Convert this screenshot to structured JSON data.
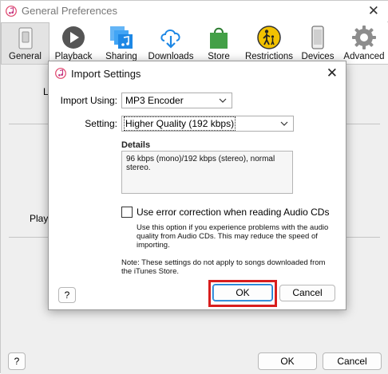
{
  "window": {
    "title": "General Preferences",
    "close_glyph": "✕"
  },
  "toolbar": {
    "items": [
      {
        "label": "General",
        "icon": "general-switch-icon",
        "active": true
      },
      {
        "label": "Playback",
        "icon": "play-icon"
      },
      {
        "label": "Sharing",
        "icon": "sharing-icon"
      },
      {
        "label": "Downloads",
        "icon": "cloud-download-icon"
      },
      {
        "label": "Store",
        "icon": "shopping-bag-icon"
      },
      {
        "label": "Restrictions",
        "icon": "restrictions-icon"
      },
      {
        "label": "Devices",
        "icon": "phone-icon"
      },
      {
        "label": "Advanced",
        "icon": "gear-icon"
      }
    ]
  },
  "background": {
    "frag_l": "L",
    "frag_playb": "Playb",
    "help_label": "?",
    "ok_label": "OK",
    "cancel_label": "Cancel"
  },
  "dialog": {
    "title": "Import Settings",
    "close_glyph": "✕",
    "import_using_label": "Import Using:",
    "import_using_value": "MP3 Encoder",
    "setting_label": "Setting:",
    "setting_value": "Higher Quality (192 kbps)",
    "details_heading": "Details",
    "details_text": "96 kbps (mono)/192 kbps (stereo), normal stereo.",
    "error_correction_label": "Use error correction when reading Audio CDs",
    "error_correction_checked": false,
    "hint_text": "Use this option if you experience problems with the audio quality from Audio CDs.  This may reduce the speed of importing.",
    "note_text": "Note: These settings do not apply to songs downloaded from the iTunes Store.",
    "help_label": "?",
    "ok_label": "OK",
    "cancel_label": "Cancel"
  },
  "colors": {
    "highlight_border": "#d81e1e",
    "focus_blue": "#1a7bd1",
    "play_icon": "#555555",
    "sharing_icon": "#1e88e5",
    "downloads_icon": "#1e88e5",
    "store_icon": "#43a047",
    "restrictions_icon": "#f2c200"
  }
}
